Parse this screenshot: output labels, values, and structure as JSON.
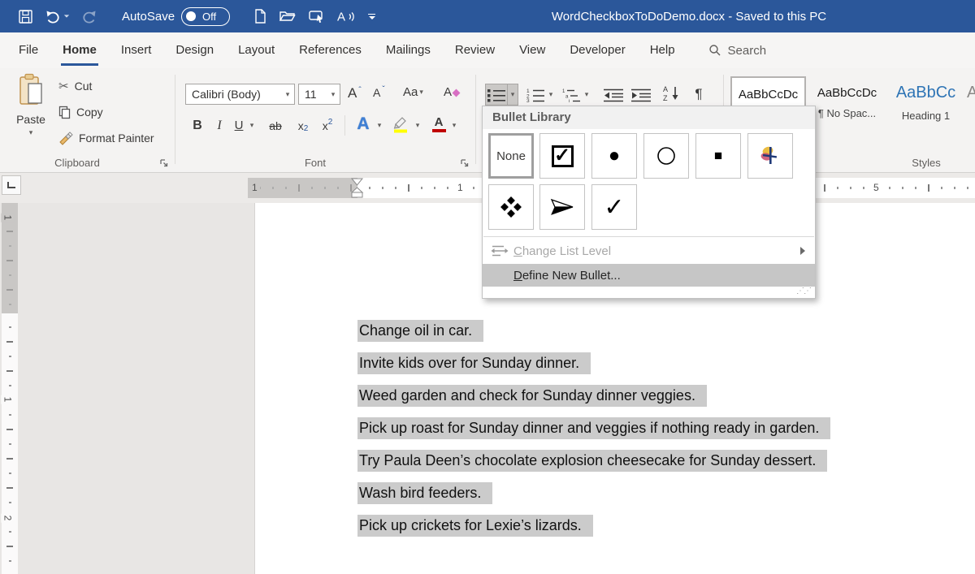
{
  "titlebar": {
    "autosave_label": "AutoSave",
    "autosave_state": "Off",
    "title": "WordCheckboxToDoDemo.docx - Saved to this PC"
  },
  "tabs": {
    "items": [
      {
        "label": "File"
      },
      {
        "label": "Home"
      },
      {
        "label": "Insert"
      },
      {
        "label": "Design"
      },
      {
        "label": "Layout"
      },
      {
        "label": "References"
      },
      {
        "label": "Mailings"
      },
      {
        "label": "Review"
      },
      {
        "label": "View"
      },
      {
        "label": "Developer"
      },
      {
        "label": "Help"
      }
    ],
    "search_label": "Search"
  },
  "ribbon": {
    "clipboard": {
      "group_label": "Clipboard",
      "paste_label": "Paste",
      "cut_label": "Cut",
      "copy_label": "Copy",
      "format_painter_label": "Format Painter"
    },
    "font": {
      "group_label": "Font",
      "font_name": "Calibri (Body)",
      "font_size": "11",
      "grow_label": "A",
      "shrink_label": "A",
      "case_label": "Aa",
      "clear_label": "A",
      "bold_label": "B",
      "italic_label": "I",
      "underline_label": "U",
      "strikethrough_label": "ab",
      "sub_base": "x",
      "sub_digit": "2",
      "sup_base": "x",
      "sup_digit": "2",
      "texteffects_label": "A",
      "fontcolor_label": "A"
    },
    "paragraph": {
      "pilcrow": "¶"
    },
    "styles": {
      "group_label": "Styles",
      "cards": [
        {
          "sample": "AaBbCcDc",
          "label": ""
        },
        {
          "sample": "AaBbCcDc",
          "label": "¶ No Spac..."
        },
        {
          "sample": "AaBbCc",
          "label": "Heading 1"
        },
        {
          "sample": "A",
          "label": ""
        }
      ]
    }
  },
  "ruler": {
    "h_numbers": [
      "1",
      "1",
      "5"
    ],
    "v_numbers": [
      "1",
      "1",
      "2"
    ]
  },
  "bullet_menu": {
    "header": "Bullet Library",
    "none_label": "None",
    "glyphs": {
      "box_check": "✓",
      "filled_circle": "●",
      "hollow_circle": "○",
      "filled_square": "■",
      "checkmark": "✓"
    },
    "change_list_level_label": "Change List Level",
    "define_new_bullet_label": "Define New Bullet..."
  },
  "document": {
    "lines": [
      "Change oil in car.",
      "Invite kids over for Sunday dinner.",
      "Weed garden and check for Sunday dinner veggies.",
      "Pick up roast for Sunday dinner and veggies if nothing ready in garden.",
      "Try Paula Deen’s chocolate explosion cheesecake for Sunday dessert.",
      "Wash bird feeders.",
      "Pick up crickets for Lexie’s lizards."
    ]
  },
  "colors": {
    "titlebar_blue": "#2b579a",
    "selection_gray": "#cbcbcb",
    "heading_blue": "#2e74b5",
    "highlight_yellow": "#ffff00",
    "fontcolor_red": "#c00000"
  }
}
